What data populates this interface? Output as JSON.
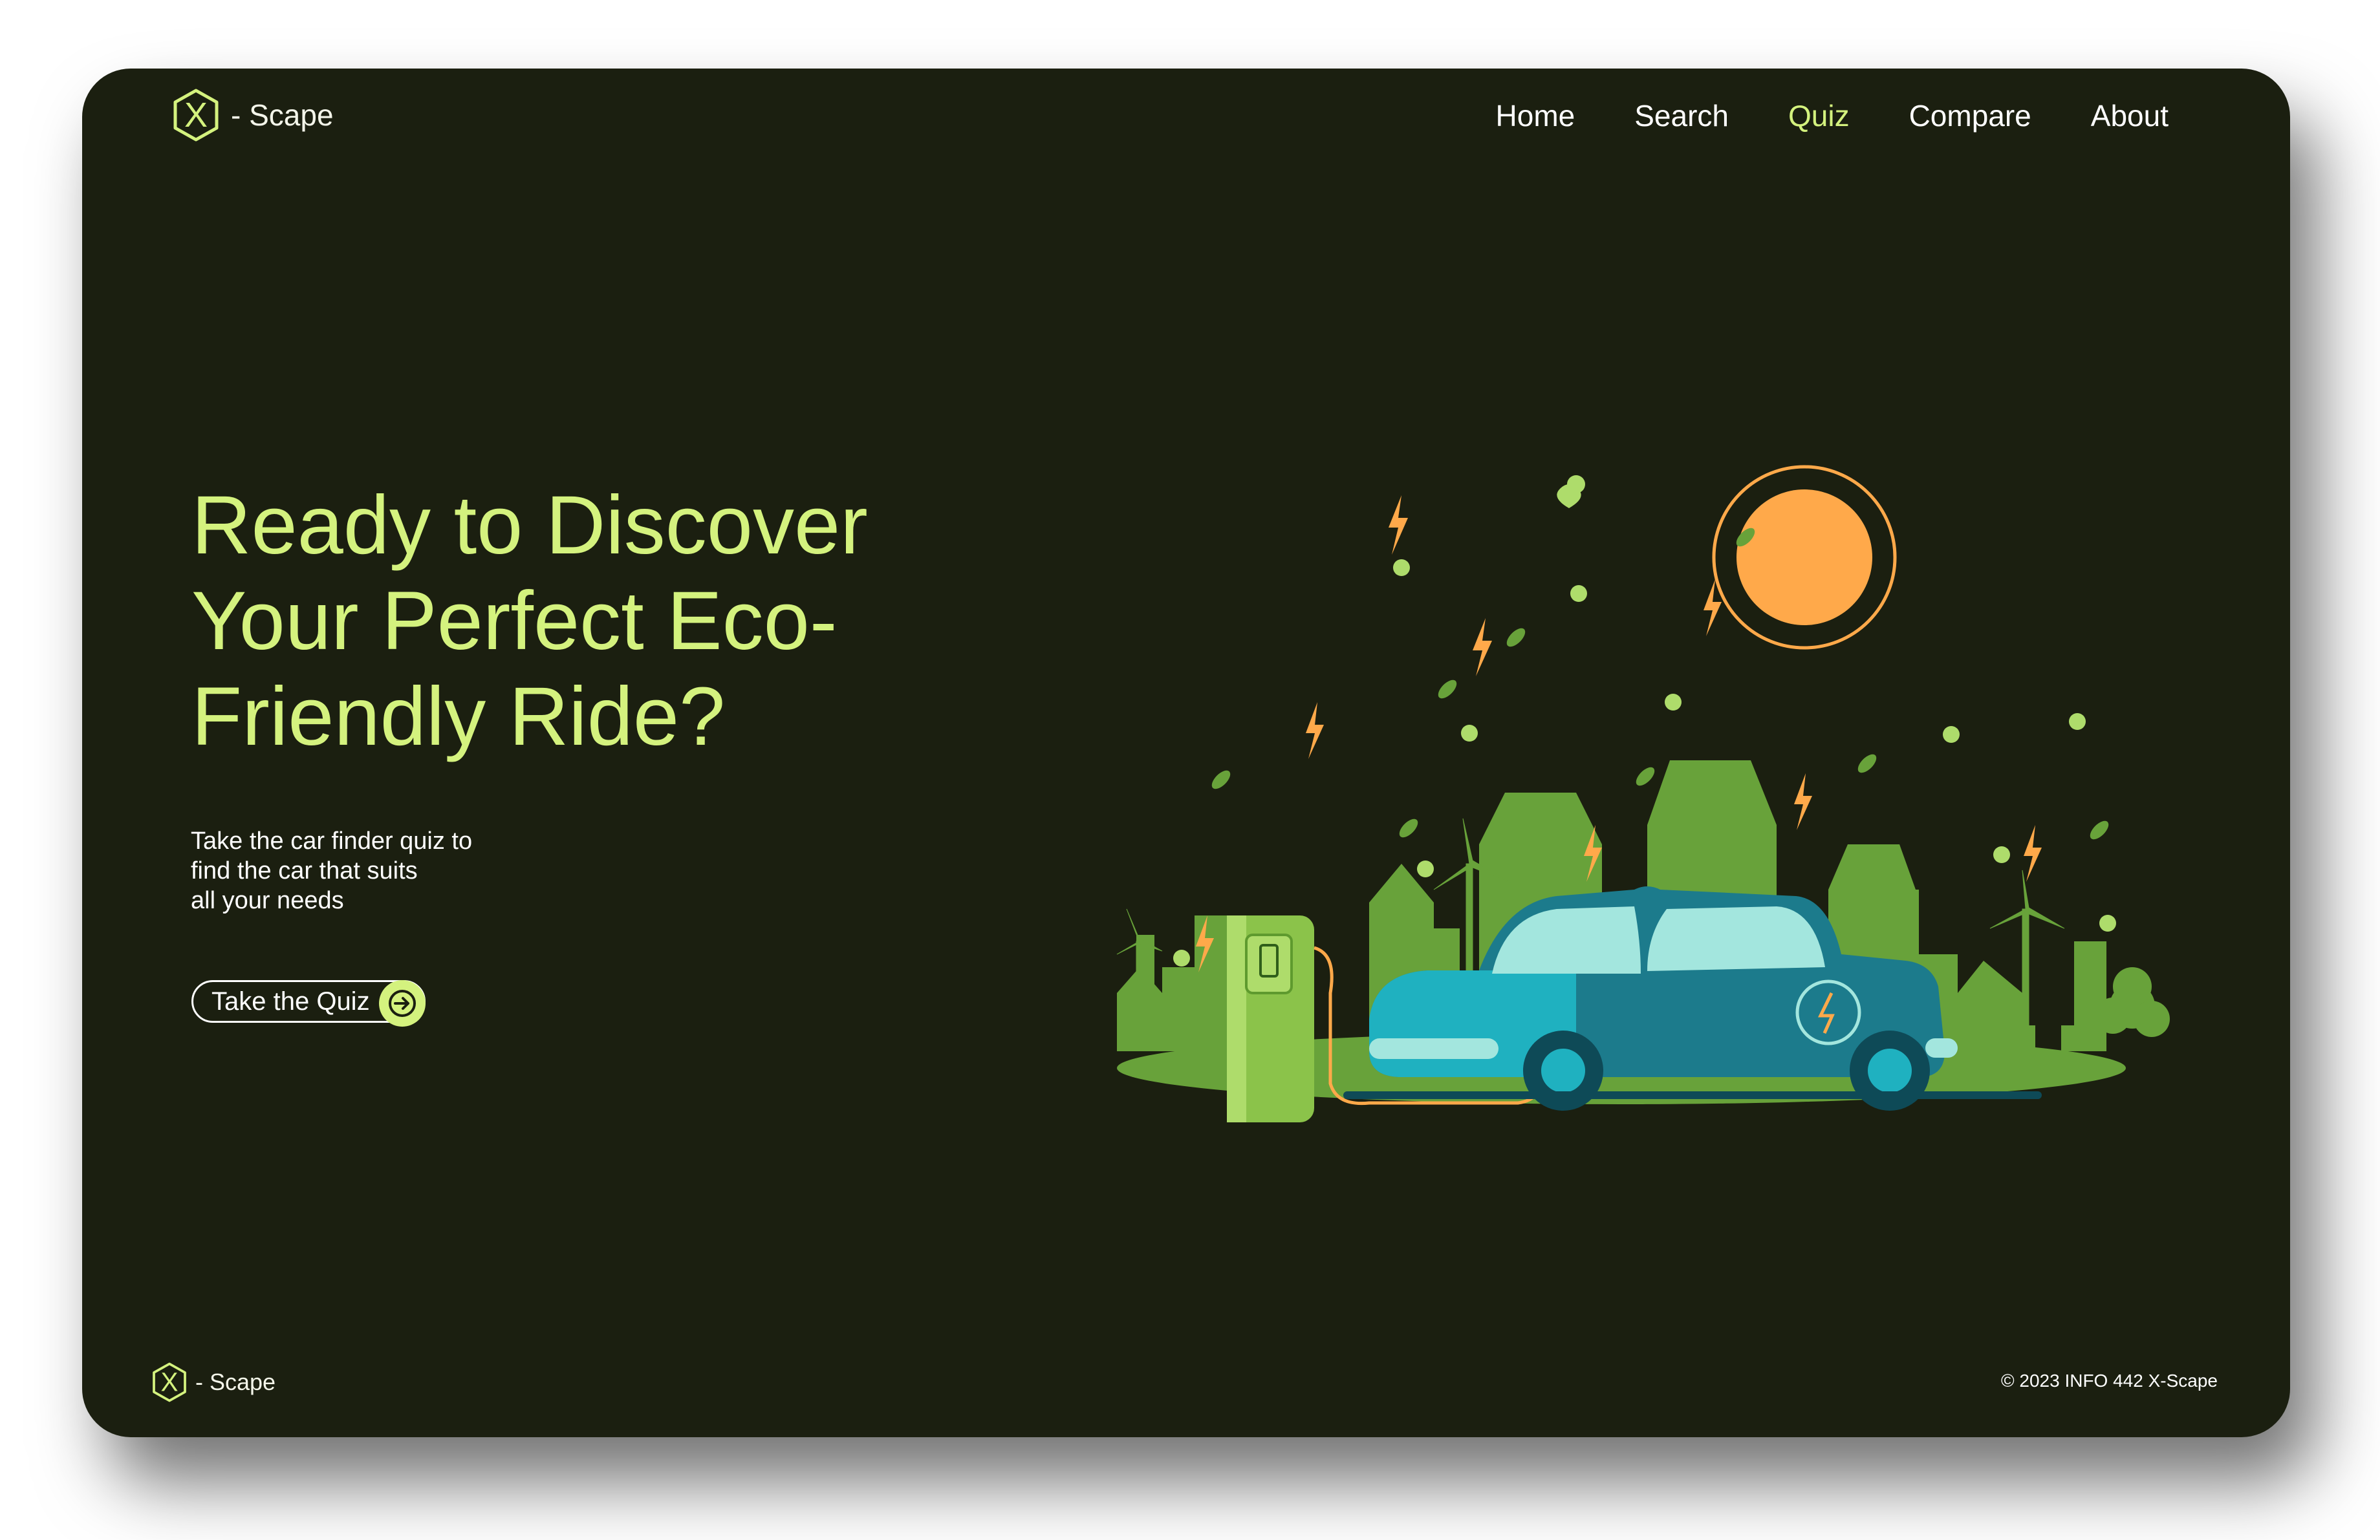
{
  "header": {
    "logo_text": "- Scape",
    "nav": [
      {
        "label": "Home"
      },
      {
        "label": "Search"
      },
      {
        "label": "Quiz"
      },
      {
        "label": "Compare"
      },
      {
        "label": "About"
      }
    ],
    "active_nav": "Quiz"
  },
  "hero": {
    "title_lines": [
      "Ready to Discover",
      "Your Perfect Eco-",
      "Friendly Ride?"
    ],
    "subtitle_lines": [
      "Take the car finder quiz to",
      "find the car that suits",
      "all your needs"
    ],
    "cta_label": "Take the Quiz"
  },
  "footer": {
    "logo_text": "- Scape",
    "copyright": "© 2023 INFO 442 X-Scape"
  },
  "colors": {
    "background": "#1b1f10",
    "accent": "#d4f27e",
    "sun": "#ffa94a",
    "car": "#1c7b8c",
    "grass": "#68a23a"
  },
  "icons": [
    "x-scape-logo-icon",
    "arrow-right-icon"
  ]
}
